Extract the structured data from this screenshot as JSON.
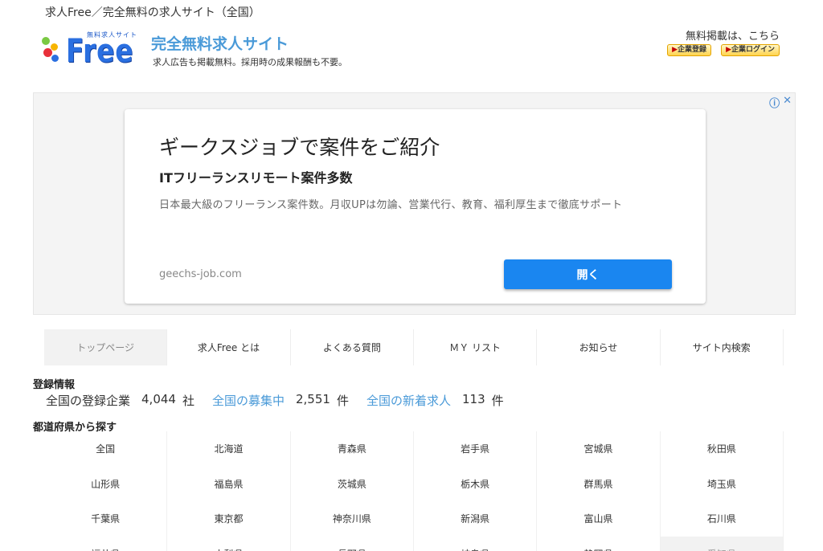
{
  "header": {
    "tagline": "求人Free／完全無料の求人サイト（全国）",
    "logo_small_text": "無料求人サイト",
    "logo_word": "Free",
    "site_name": "完全無料求人サイト",
    "site_desc": "求人広告も掲載無料。採用時の成果報酬も不要。",
    "free_post": "無料掲載は、こちら",
    "company_register": "企業登録",
    "company_login": "企業ログイン",
    "accent_color": "#4a9ad8"
  },
  "ad": {
    "headline": "ギークスジョブで案件をご紹介",
    "subhead": "ITフリーランスリモート案件多数",
    "body": "日本最大級のフリーランス案件数。月収UPは勿論、営業代行、教育、福利厚生まで徹底サポート",
    "domain": "geechs-job.com",
    "button": "開く",
    "info_icon": "ⓘ",
    "close_icon": "✕",
    "button_color": "#1a86f0"
  },
  "nav": {
    "items": [
      {
        "label": "トップページ"
      },
      {
        "label": "求人Free とは"
      },
      {
        "label": "よくある質問"
      },
      {
        "label": "ＭＹ リスト"
      },
      {
        "label": "お知らせ"
      },
      {
        "label": "サイト内検索"
      }
    ]
  },
  "registration": {
    "title": "登録情報",
    "companies_label": "全国の登録企業",
    "companies_count": "4,044",
    "companies_unit": "社",
    "recruiting_label": "全国の募集中",
    "recruiting_count": "2,551",
    "recruiting_unit": "件",
    "new_label": "全国の新着求人",
    "new_count": "113",
    "new_unit": "件"
  },
  "prefectures": {
    "title": "都道府県から探す",
    "items": [
      "全国",
      "北海道",
      "青森県",
      "岩手県",
      "宮城県",
      "秋田県",
      "山形県",
      "福島県",
      "茨城県",
      "栃木県",
      "群馬県",
      "埼玉県",
      "千葉県",
      "東京都",
      "神奈川県",
      "新潟県",
      "富山県",
      "石川県",
      "福井県",
      "山梨県",
      "長野県",
      "岐阜県",
      "静岡県",
      "愛知県"
    ]
  }
}
